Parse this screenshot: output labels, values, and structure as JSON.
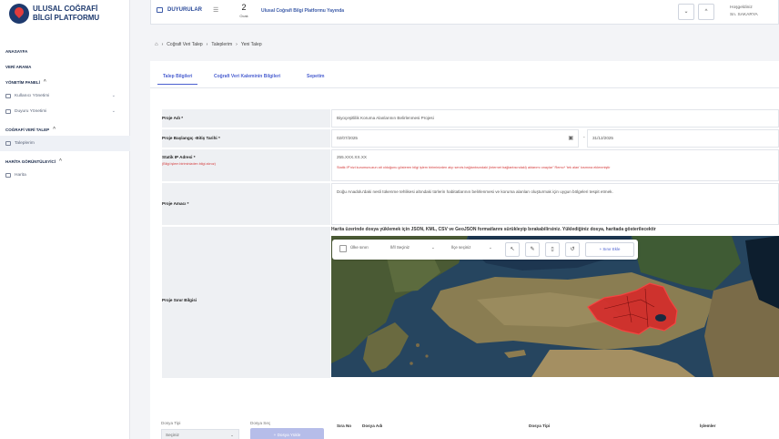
{
  "brand": {
    "line1": "ULUSAL COĞRAFİ",
    "line2": "BİLGİ PLATFORMU"
  },
  "sidebar": {
    "sections": [
      {
        "title": "ANASAYFA"
      },
      {
        "title": "VERİ ARAMA"
      },
      {
        "title": "YÖNETİM PANELİ",
        "items": [
          "Kullanıcı Yönetimi",
          "Duyuru Yönetimi"
        ]
      },
      {
        "title": "COĞRAFİ VERİ TALEP",
        "items": [
          "Taleplerim"
        ]
      },
      {
        "title": "HARİTA GÖRÜNTÜLEYİCİ",
        "items": [
          "Harita"
        ]
      }
    ]
  },
  "topbar": {
    "announcements_label": "DUYURULAR",
    "date_day": "2",
    "date_month": "Ocak",
    "ticker": "Ulusal Coğrafi Bilgi Platformu Yayında",
    "welcome": "Hoşgeldiniz",
    "user": "Sn. SAKARYA"
  },
  "breadcrumb": [
    "Coğrafi Veri Talep",
    "Taleplerim",
    "Yeni Talep"
  ],
  "tabs": [
    "Talep Bilgileri",
    "Coğrafi Veri Kaleminin Bilgileri",
    "Sepetim"
  ],
  "form": {
    "project_name_label": "Proje Adı *",
    "project_name_value": "Biyoçeşitlilik Koruma Alanlarının Belirlenmesi Projesi",
    "date_label": "Proje Başlangıç -Bitiş Tarihi *",
    "start_date": "02/07/2025",
    "date_sep": "-",
    "end_date": "31/12/2025",
    "ip_label": "Statik IP Adresi *",
    "ip_hint": "(Bilgi işlem biriminizden bilgi alınız)",
    "ip_value": "255.XXX.XX.XX",
    "ip_warning": "Statik IP'nizi kurumunuzun ait olduğunu gösteren bilgi işlem biriminizden alıp servis bağlantısındaki (internet bağlantısındaki) aktarımı onaylar\" Remo* 'tek alan' kısmına eklenmiştir",
    "purpose_label": "Proje Amacı *",
    "purpose_value": "Doğu Anadolu'daki nesli tükenme tehlikesi altındaki türlerin habitatlarının belirlenmesi ve koruma alanları oluşturmak için uygun bölgeleri tespit etmek.",
    "boundary_label": "Proje Sınır Bilgisi"
  },
  "map": {
    "instruction": "Harita üzerinde dosya yüklemek için JSON, KML, CSV ve GeoJSON formatlarını sürükleyip bırakabilirsiniz. Yüklediğiniz dosya, haritada gösterilecektir",
    "checkbox_label": "Ülke sınırı",
    "province_select": "İl/İl Seçiniz",
    "district_select": "İlçe seçiniz",
    "add_area_button": "+ Sınır Ekle"
  },
  "bottom": {
    "file_type_label": "Dosya Tipi",
    "file_type_value": "Seçiniz",
    "file_select_label": "Dosya Seç",
    "file_select_button": "+ Dosya Yükle",
    "table_headers": [
      "Sıra No",
      "Dosya Adı",
      "Dosya Tipi",
      "İşlemler"
    ]
  },
  "colors": {
    "accent": "#4a5fd0",
    "brand": "#1e3a6e",
    "warning": "#d43b3b",
    "boundary": "#e0262a"
  }
}
